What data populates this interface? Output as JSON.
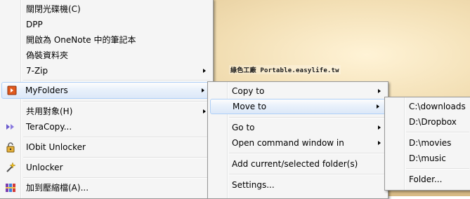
{
  "watermark": "綠色工廠 Portable.easylife.tw",
  "main_menu": {
    "items": [
      {
        "label": "關閉光碟機(C)"
      },
      {
        "label": "DPP"
      },
      {
        "label": "開啟為 OneNote 中的筆記本"
      },
      {
        "label": "偽裝資料夾"
      },
      {
        "label": "7-Zip"
      },
      {
        "label": "MyFolders"
      },
      {
        "label": "共用對象(H)"
      },
      {
        "label": "TeraCopy..."
      },
      {
        "label": "IObit Unlocker"
      },
      {
        "label": "Unlocker"
      },
      {
        "label": "加到壓縮檔(A)..."
      }
    ]
  },
  "myfolders_menu": {
    "items": [
      {
        "label": "Copy to"
      },
      {
        "label": "Move to"
      },
      {
        "label": "Go to"
      },
      {
        "label": "Open command window in"
      },
      {
        "label": "Add current/selected folder(s)"
      },
      {
        "label": "Settings..."
      }
    ]
  },
  "moveto_menu": {
    "items": [
      {
        "label": "C:\\downloads"
      },
      {
        "label": "D:\\Dropbox"
      },
      {
        "label": "D:\\movies"
      },
      {
        "label": "D:\\music"
      },
      {
        "label": "Folder..."
      }
    ]
  },
  "colors": {
    "highlight_border": "#aecff7",
    "highlight_fill": "#dce8f8",
    "menu_bg": "#f5f5f5",
    "myfolders_icon": "#e05a1e",
    "teracopy_icon": "#6a5acd"
  }
}
